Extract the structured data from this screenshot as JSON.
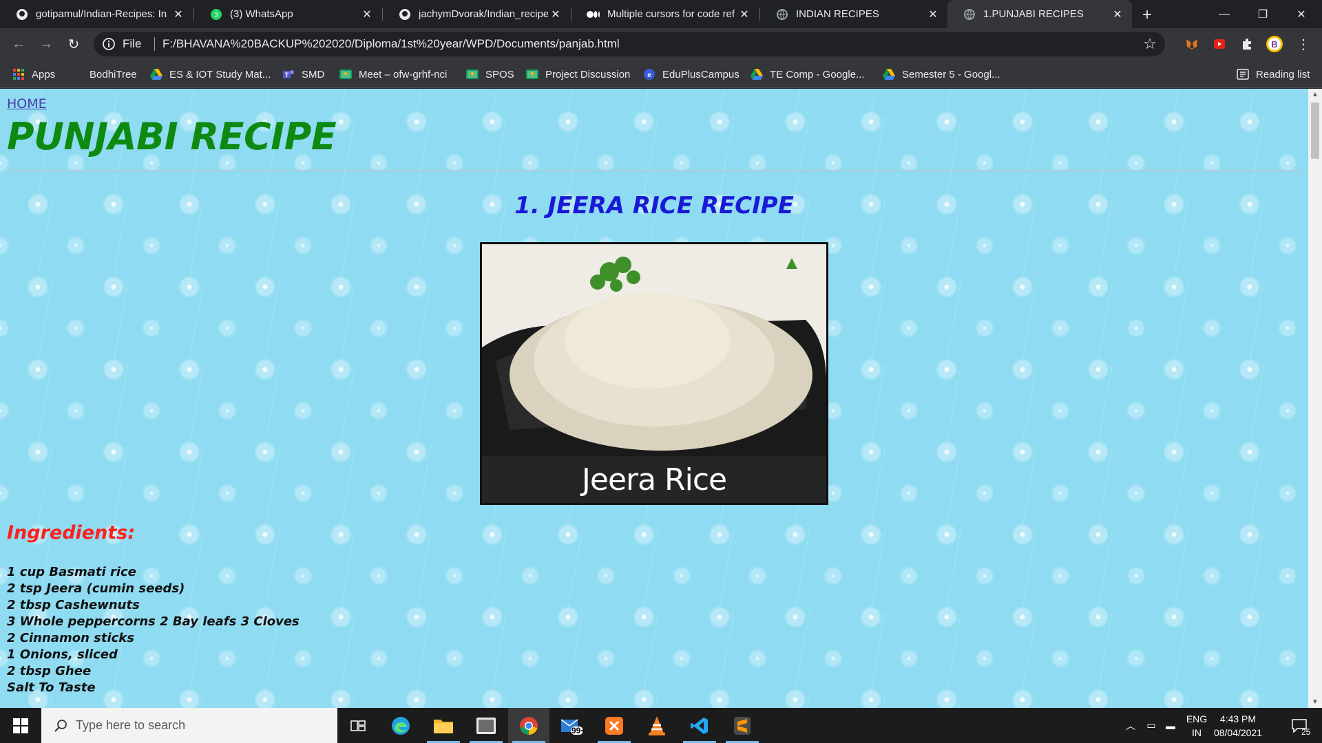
{
  "browser": {
    "tabs": [
      {
        "title": "gotipamul/Indian-Recipes: In",
        "icon": "github-icon"
      },
      {
        "title": "(3) WhatsApp",
        "icon": "whatsapp-icon"
      },
      {
        "title": "jachymDvorak/Indian_recipe",
        "icon": "github-icon"
      },
      {
        "title": "Multiple cursors for code ref",
        "icon": "medium-icon"
      },
      {
        "title": "INDIAN RECIPES",
        "icon": "globe-icon"
      },
      {
        "title": "1.PUNJABI RECIPES",
        "icon": "globe-icon",
        "active": true
      }
    ],
    "omnibox": {
      "scheme_label": "File",
      "url": "F:/BHAVANA%20BACKUP%202020/Diploma/1st%20year/WPD/Documents/panjab.html"
    },
    "bookmarks": [
      {
        "label": "Apps",
        "icon": "apps-grid-icon"
      },
      {
        "label": "BodhiTree",
        "icon": ""
      },
      {
        "label": "ES & IOT Study Mat...",
        "icon": "drive-icon"
      },
      {
        "label": "SMD",
        "icon": "teams-icon"
      },
      {
        "label": "Meet – ofw-grhf-nci",
        "icon": "classroom-icon"
      },
      {
        "label": "SPOS",
        "icon": "classroom-icon"
      },
      {
        "label": "Project Discussion",
        "icon": "classroom-icon"
      },
      {
        "label": "EduPlusCampus",
        "icon": "eduplus-icon"
      },
      {
        "label": "TE Comp - Google...",
        "icon": "drive-icon"
      },
      {
        "label": "Semester 5 - Googl...",
        "icon": "drive-icon"
      }
    ],
    "reading_list": "Reading list"
  },
  "page": {
    "home_link": "HOME",
    "title": "PUNJABI RECIPE",
    "recipe_title": "1. JEERA RICE RECIPE",
    "image_caption": "Jeera Rice",
    "ingredients_heading": "Ingredients:",
    "ingredients": [
      "1 cup Basmati rice",
      "2 tsp Jeera (cumin seeds)",
      "2 tbsp Cashewnuts",
      "3 Whole peppercorns 2 Bay leafs 3 Cloves",
      "2 Cinnamon sticks",
      "1 Onions, sliced",
      "2 tbsp Ghee",
      "Salt To Taste"
    ]
  },
  "taskbar": {
    "search_placeholder": "Type here to search",
    "mail_badge": "99+",
    "lang_line1": "ENG",
    "lang_line2": "IN",
    "time": "4:43 PM",
    "date": "08/04/2021",
    "notifications": "25"
  }
}
